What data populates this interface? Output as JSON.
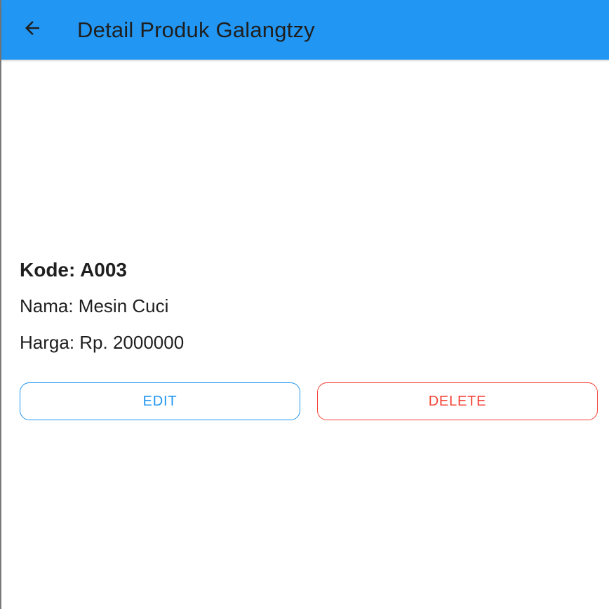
{
  "appbar": {
    "back_icon": "arrow-back-icon",
    "title": "Detail Produk Galangtzy",
    "background_color": "#2196f3"
  },
  "product": {
    "kode": "Kode: A003",
    "nama": "Nama: Mesin Cuci",
    "harga": "Harga: Rp. 2000000"
  },
  "actions": {
    "edit_label": "EDIT",
    "edit_color": "#2196f3",
    "delete_label": "DELETE",
    "delete_color": "#f44336"
  }
}
